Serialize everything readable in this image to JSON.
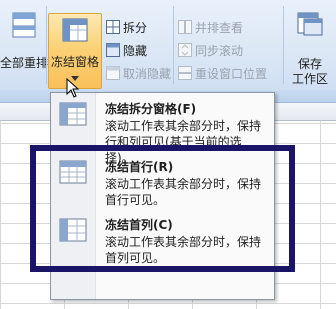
{
  "ribbon": {
    "arrange_all": "全部重排",
    "freeze_panes": "冻结窗格",
    "split": "拆分",
    "hide": "隐藏",
    "unhide": "取消隐藏",
    "view_side_by_side": "并排查看",
    "sync_scroll": "同步滚动",
    "reset_window_position": "重设窗口位置",
    "save_workspace_line1": "保存",
    "save_workspace_line2": "工作区"
  },
  "menu": {
    "items": [
      {
        "title": "冻结拆分窗格(F)",
        "desc": "滚动工作表其余部分时，保持行和列可见(基于当前的选择)。"
      },
      {
        "title": "冻结首行(R)",
        "desc": "滚动工作表其余部分时，保持首行可见。"
      },
      {
        "title": "冻结首列(C)",
        "desc": "滚动工作表其余部分时，保持首列可见。"
      }
    ]
  },
  "colors": {
    "highlight": "#1a1566",
    "pressed": "#fbd277"
  }
}
